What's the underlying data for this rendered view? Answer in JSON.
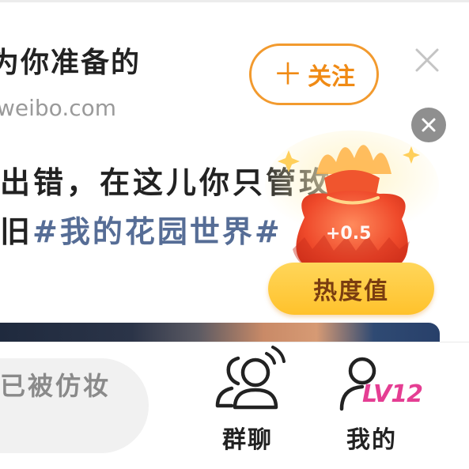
{
  "post": {
    "title": "为你准备的",
    "source": "weibo.com",
    "follow_label": "关注",
    "body_line1": "出错，在这儿你只管",
    "body_line1_tail": "玫",
    "body_line2_prefix": "旧",
    "body_line2_hashtag": "#我的花园世界#"
  },
  "heat_popup": {
    "value": "+0.5",
    "label": "热度值"
  },
  "bottom_bar": {
    "comment_placeholder": "已被仿妆",
    "nav": {
      "group_chat_label": "群聊",
      "me_label": "我的",
      "level_badge": "LV12"
    }
  },
  "colors": {
    "accent_orange": "#f08a14",
    "hashtag_blue": "#566d96",
    "level_pink": "#e53e93",
    "heat_pill": "#ffc22c"
  }
}
